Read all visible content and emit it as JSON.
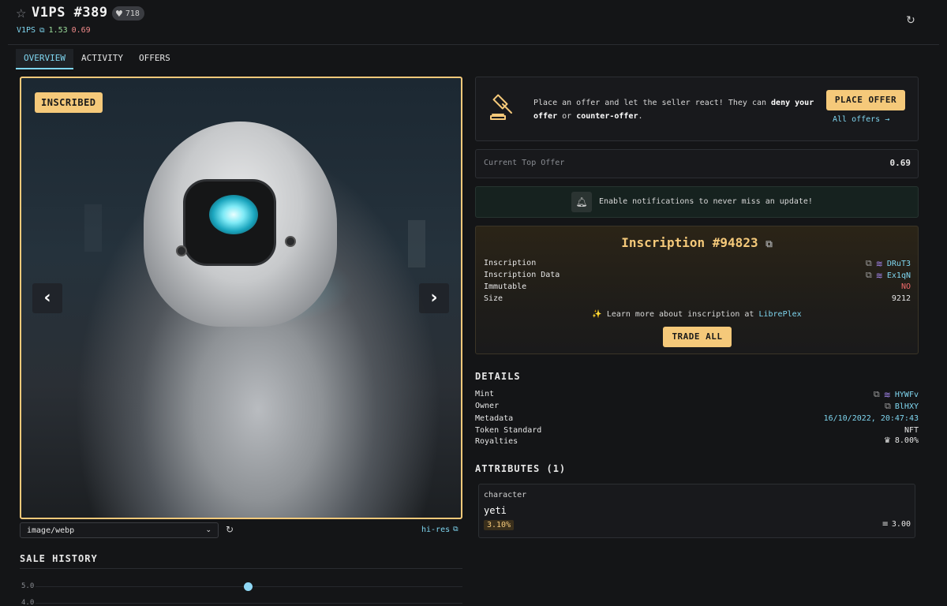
{
  "header": {
    "title": "V1PS #389",
    "likes": "718",
    "collection": "V1PS",
    "floor_price": "1.53",
    "top_offer_price": "0.69"
  },
  "tabs": [
    {
      "label": "OVERVIEW",
      "active": true
    },
    {
      "label": "ACTIVITY",
      "active": false
    },
    {
      "label": "OFFERS",
      "active": false
    }
  ],
  "image": {
    "badge": "INSCRIBED",
    "format": "image/webp",
    "hires_label": "hi-res"
  },
  "sale_history": {
    "title": "SALE HISTORY",
    "ticks": [
      "5.0",
      "4.0"
    ]
  },
  "offer": {
    "text_1": "Place an offer and let the seller react! They can ",
    "bold_1": "deny your offer",
    "text_2": " or ",
    "bold_2": "counter-offer",
    "text_3": ".",
    "button": "PLACE OFFER",
    "all_offers": "All offers →"
  },
  "top_offer": {
    "label": "Current Top Offer",
    "value": "0.69"
  },
  "notification": {
    "text": "Enable notifications to never miss an update!"
  },
  "inscription": {
    "title": "Inscription #94823",
    "rows": [
      {
        "label": "Inscription",
        "value": "DRuT3"
      },
      {
        "label": "Inscription Data",
        "value": "Ex1qN"
      },
      {
        "label": "Immutable",
        "value": "NO"
      },
      {
        "label": "Size",
        "value": "9212"
      }
    ],
    "learn_prefix": "Learn more about inscription at ",
    "learn_link": "LibrePlex",
    "button": "TRADE ALL"
  },
  "details": {
    "title": "DETAILS",
    "rows": [
      {
        "label": "Mint",
        "value": "HYWFv"
      },
      {
        "label": "Owner",
        "value": "BlHXY"
      },
      {
        "label": "Metadata",
        "value": "16/10/2022, 20:47:43"
      },
      {
        "label": "Token Standard",
        "value": "NFT"
      },
      {
        "label": "Royalties",
        "value": "8.00%"
      }
    ]
  },
  "attributes": {
    "title": "ATTRIBUTES (1)",
    "items": [
      {
        "trait_type": "character",
        "value": "yeti",
        "rarity": "3.10%",
        "price": "3.00"
      }
    ]
  },
  "colors": {
    "accent_cyan": "#7fd6f0",
    "gold": "#f5c97a",
    "background": "#141517"
  }
}
